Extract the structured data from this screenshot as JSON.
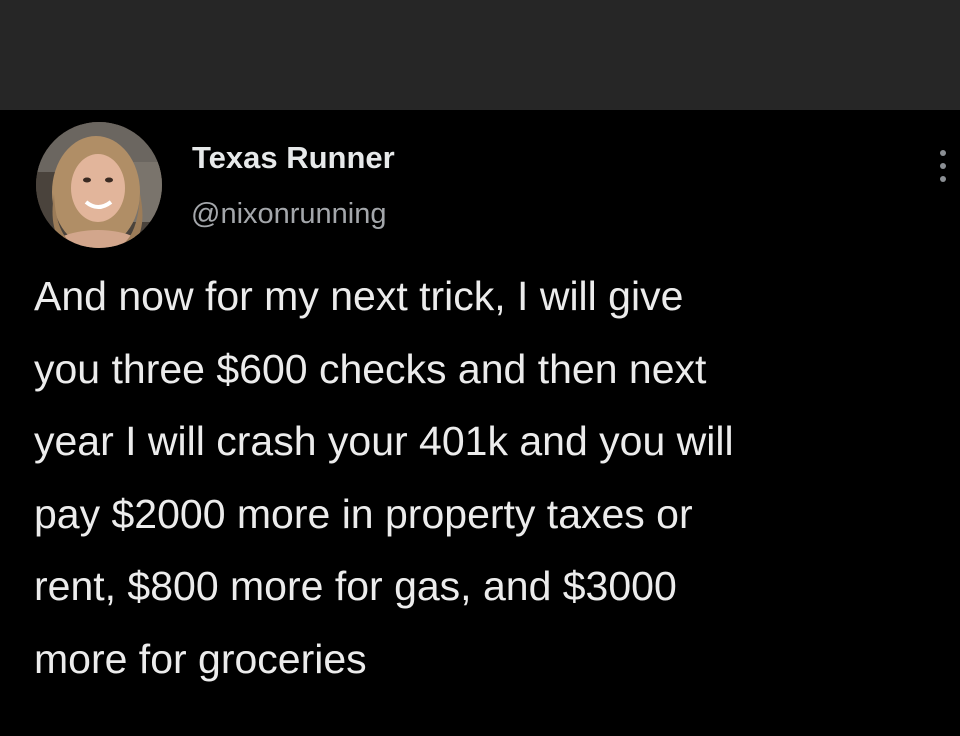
{
  "tweet": {
    "author": {
      "display_name": "Texas Runner",
      "handle": "@nixonrunning",
      "avatar_icon": "profile-photo"
    },
    "more_icon": "more-options-icon",
    "text_lines": [
      "And now for my next trick, I will give",
      "you three $600 checks and then next",
      "year I will crash your 401k and you will",
      "pay $2000 more in property taxes or",
      "rent, $800 more for gas, and $3000",
      "more for groceries"
    ]
  },
  "colors": {
    "background": "#000000",
    "top_bar": "#262626",
    "text_primary": "#e7e9ea",
    "text_secondary": "#a4a7ab"
  }
}
